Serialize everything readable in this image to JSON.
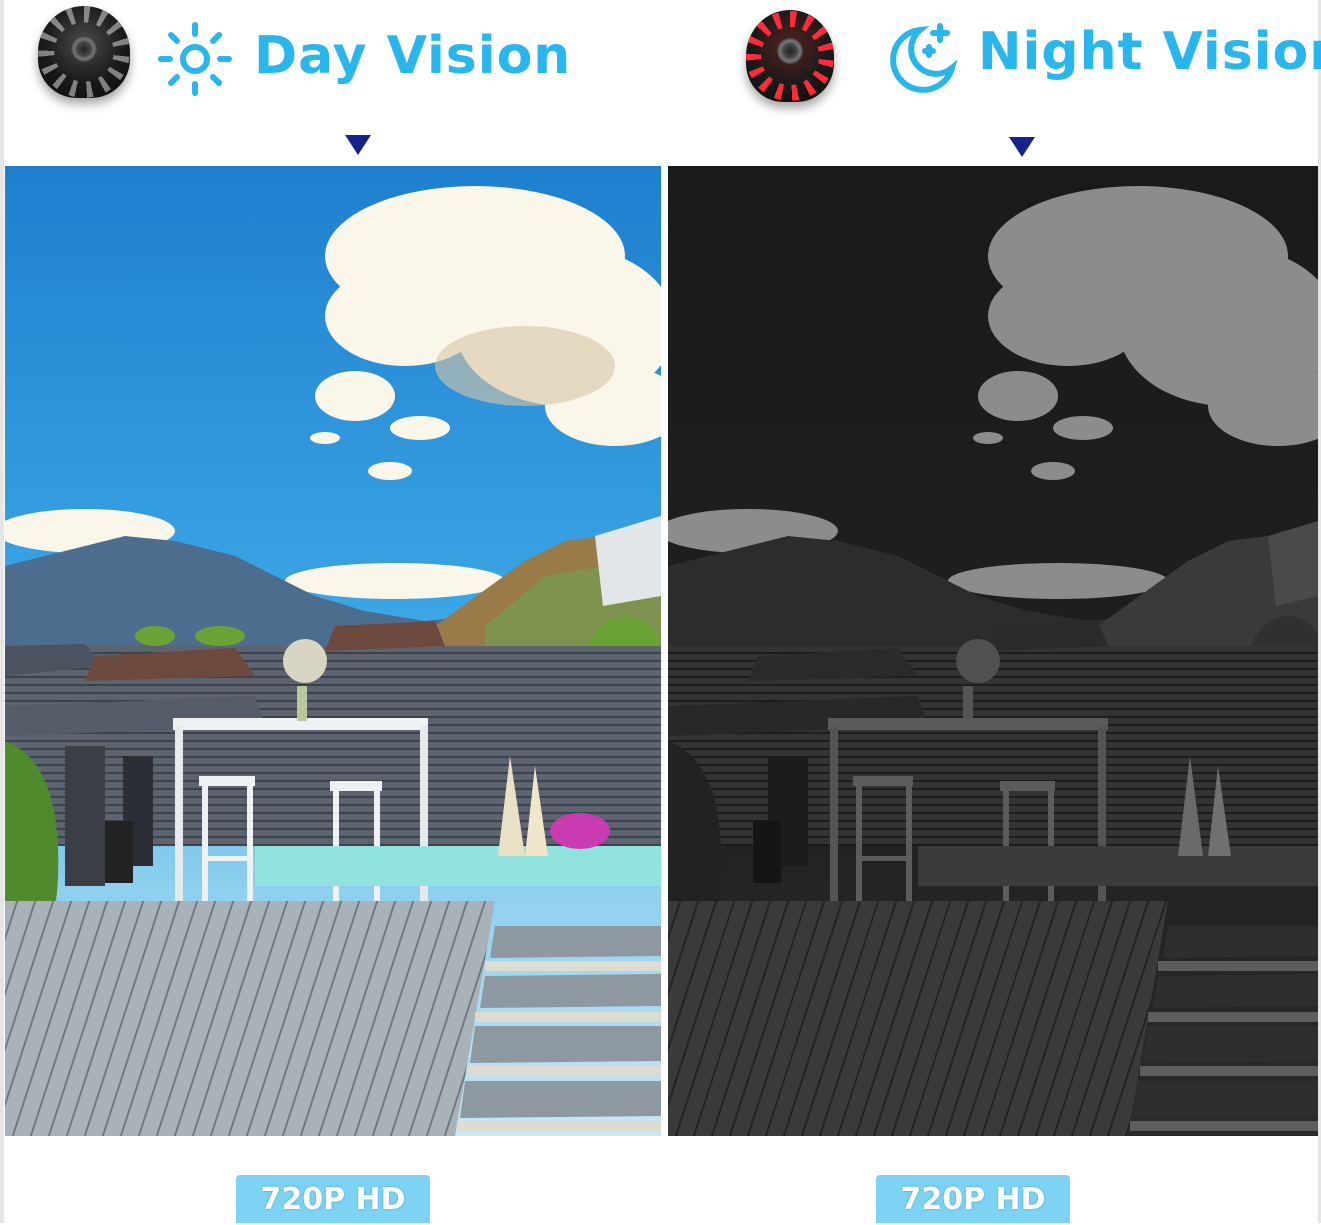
{
  "day": {
    "title": "Day Vision",
    "badge": "720P HD",
    "icon": "sun-icon",
    "accent": "#29b6ec"
  },
  "night": {
    "title": "Night Vision",
    "badge": "720P HD",
    "icon": "moon-icon",
    "accent": "#29b6ec"
  },
  "colors": {
    "marker": "#16238a",
    "badge_bg": "#7dd3f3",
    "infrared": "#ff2a3a"
  }
}
